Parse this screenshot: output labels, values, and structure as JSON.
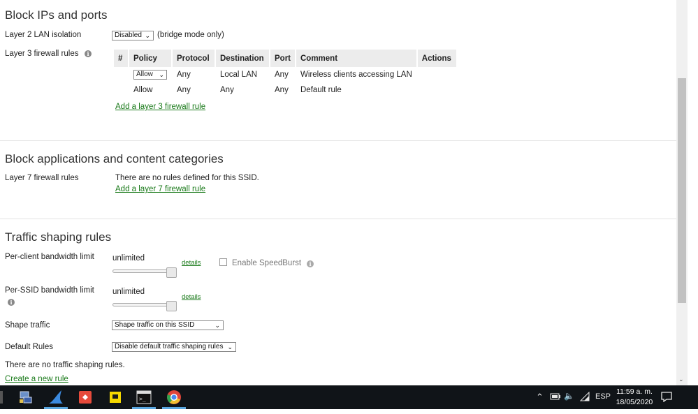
{
  "block_ips": {
    "title": "Block IPs and ports",
    "layer2_label": "Layer 2 LAN isolation",
    "layer2_value": "Disabled",
    "layer2_note": "(bridge mode only)",
    "layer3_label": "Layer 3 firewall rules",
    "table": {
      "headers": [
        "#",
        "Policy",
        "Protocol",
        "Destination",
        "Port",
        "Comment",
        "Actions"
      ],
      "rows": [
        {
          "policy": "Allow",
          "protocol": "Any",
          "destination": "Local LAN",
          "port": "Any",
          "comment": "Wireless clients accessing LAN"
        },
        {
          "policy": "Allow",
          "protocol": "Any",
          "destination": "Any",
          "port": "Any",
          "comment": "Default rule"
        }
      ]
    },
    "add_rule": "Add a layer 3 firewall rule"
  },
  "block_apps": {
    "title": "Block applications and content categories",
    "layer7_label": "Layer 7 firewall rules",
    "no_rules": "There are no rules defined for this SSID.",
    "add_rule": "Add a layer 7 firewall rule"
  },
  "traffic": {
    "title": "Traffic shaping rules",
    "per_client_label": "Per-client bandwidth limit",
    "per_client_value": "unlimited",
    "per_client_details": "details",
    "speedburst_label": "Enable SpeedBurst",
    "per_ssid_label": "Per-SSID bandwidth limit",
    "per_ssid_value": "unlimited",
    "per_ssid_details": "details",
    "shape_label": "Shape traffic",
    "shape_value": "Shape traffic on this SSID",
    "default_label": "Default Rules",
    "default_value": "Disable default traffic shaping rules",
    "no_shaping": "There are no traffic shaping rules.",
    "create_rule": "Create a new rule"
  },
  "taskbar": {
    "language": "ESP",
    "time": "11:59 a. m.",
    "date": "18/05/2020",
    "icons": [
      "network-settings-icon",
      "wireshark-icon",
      "git-icon",
      "sticky-notes-icon",
      "terminal-icon",
      "chrome-icon"
    ]
  },
  "colors": {
    "link": "#1a7a1a",
    "table_header_bg": "#ececec",
    "taskbar_bg": "#101418"
  }
}
